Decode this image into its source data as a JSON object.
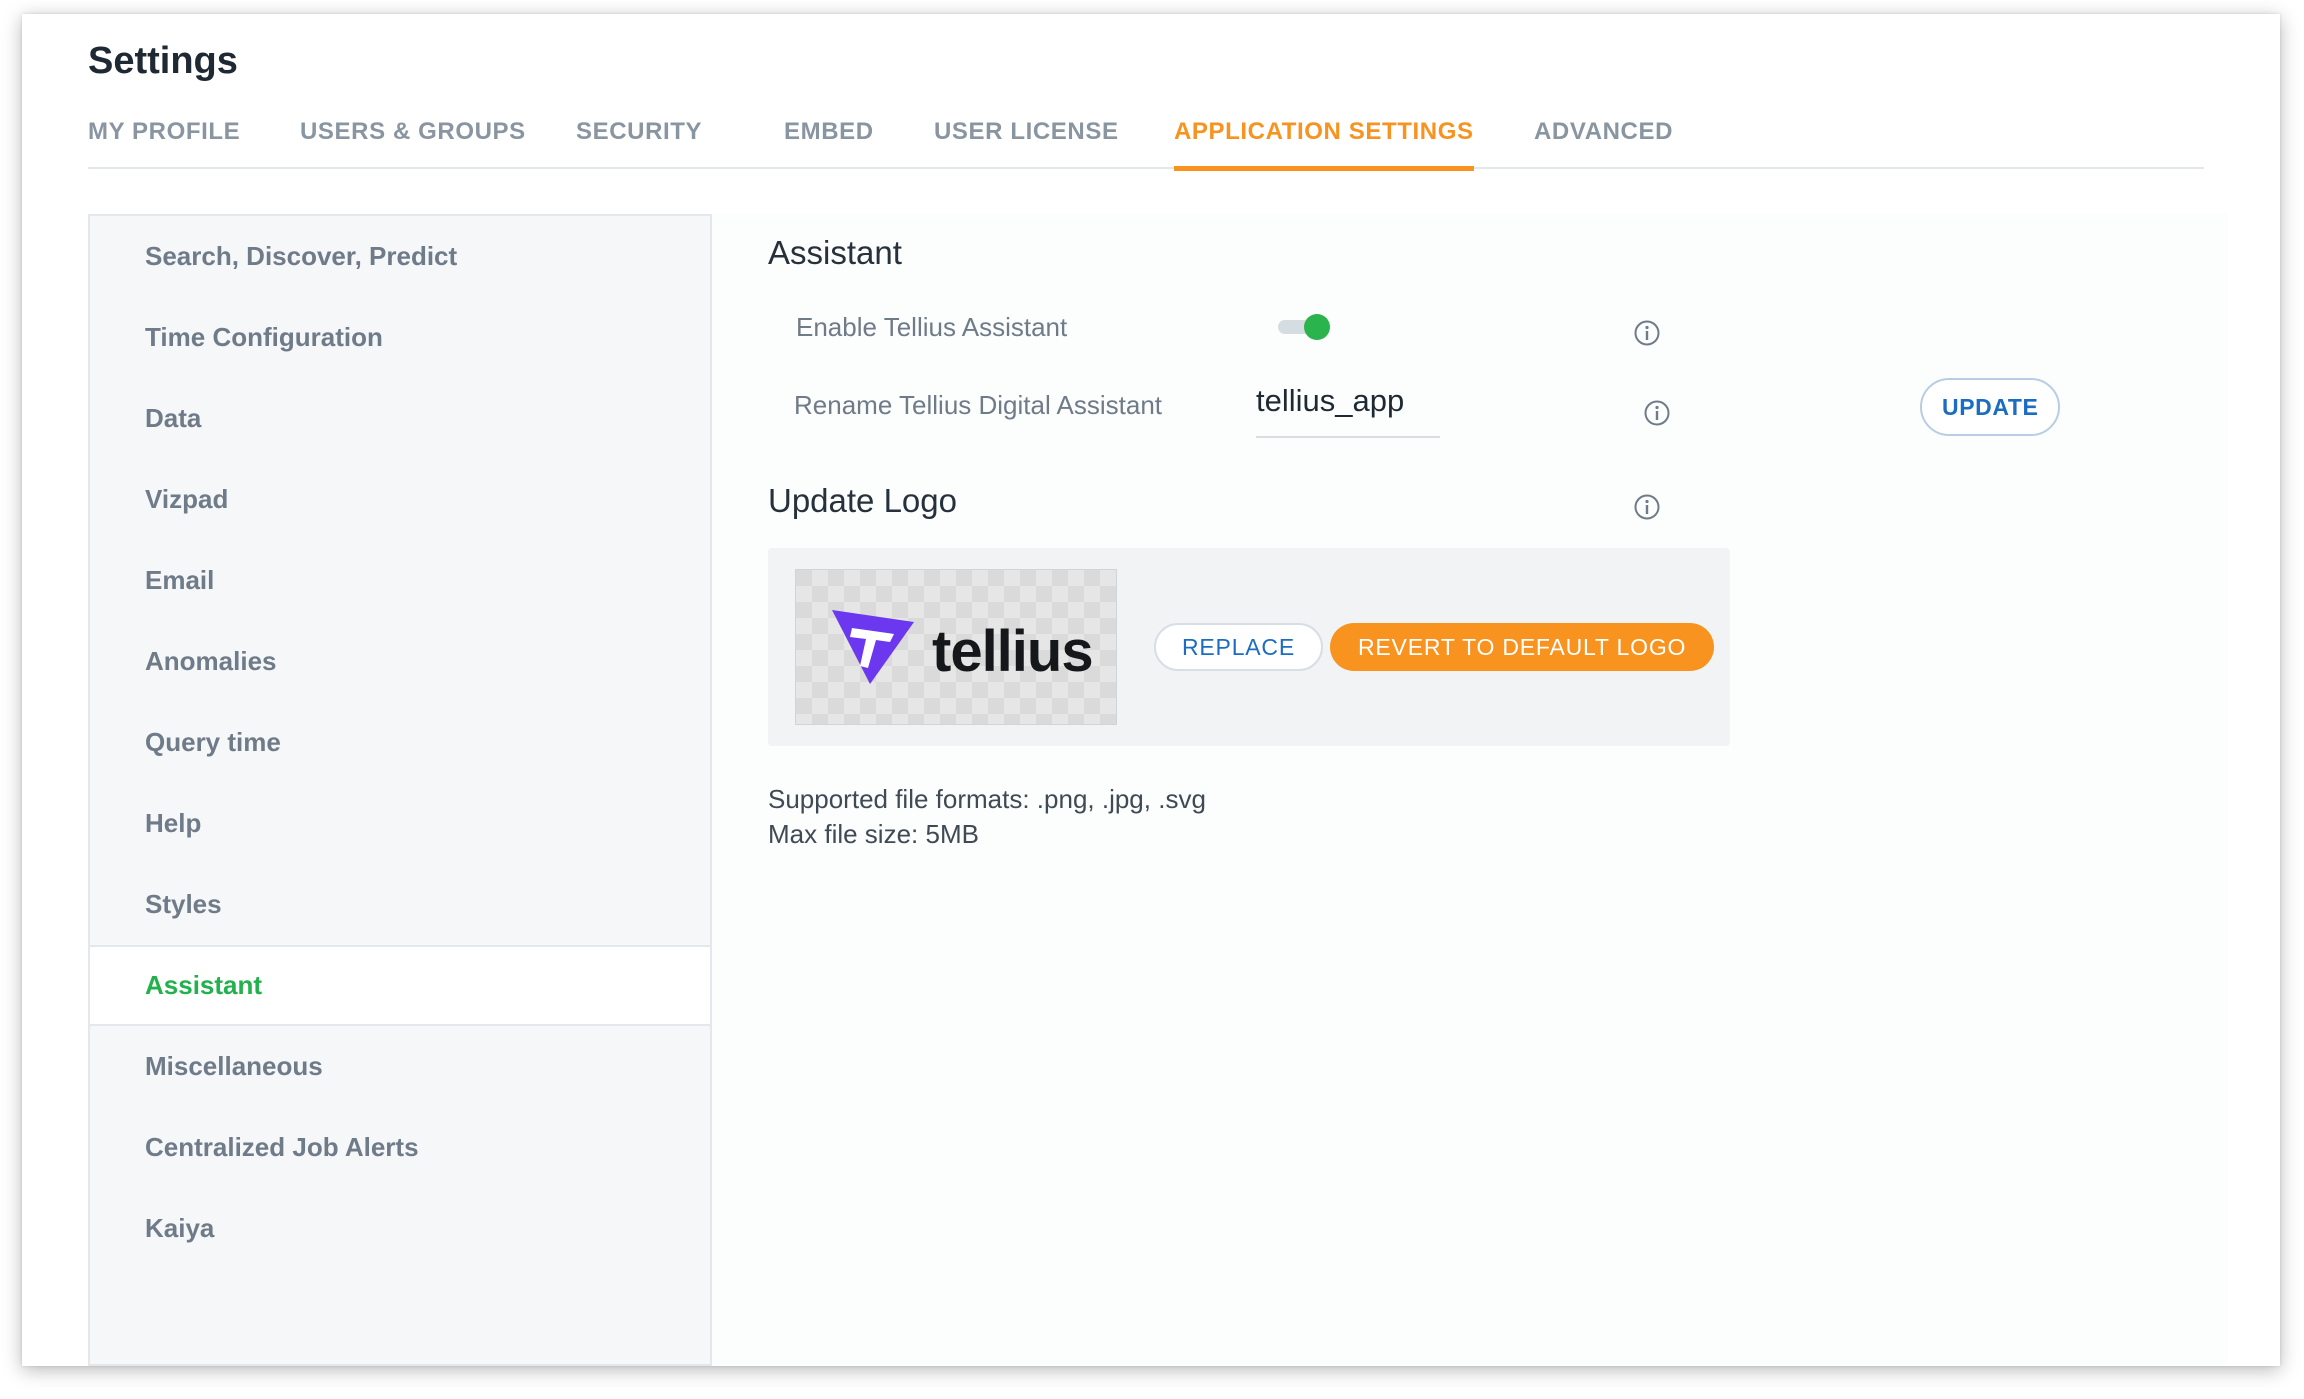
{
  "header": {
    "title": "Settings"
  },
  "tabs": [
    {
      "label": "MY PROFILE"
    },
    {
      "label": "USERS & GROUPS"
    },
    {
      "label": "SECURITY"
    },
    {
      "label": "EMBED"
    },
    {
      "label": "USER LICENSE"
    },
    {
      "label": "APPLICATION SETTINGS",
      "active": true
    },
    {
      "label": "ADVANCED"
    }
  ],
  "sidebar": {
    "items": [
      {
        "label": "Search, Discover, Predict"
      },
      {
        "label": "Time Configuration"
      },
      {
        "label": "Data"
      },
      {
        "label": "Vizpad"
      },
      {
        "label": "Email"
      },
      {
        "label": "Anomalies"
      },
      {
        "label": "Query time"
      },
      {
        "label": "Help"
      },
      {
        "label": "Styles"
      },
      {
        "label": "Assistant",
        "active": true
      },
      {
        "label": "Miscellaneous"
      },
      {
        "label": "Centralized Job Alerts"
      },
      {
        "label": "Kaiya"
      }
    ]
  },
  "assistant": {
    "title": "Assistant",
    "enable_label": "Enable Tellius Assistant",
    "enabled": true,
    "rename_label": "Rename Tellius Digital Assistant",
    "name_value": "tellius_app",
    "update_button": "UPDATE"
  },
  "logo": {
    "title": "Update Logo",
    "logo_text": "tellius",
    "replace_button": "REPLACE",
    "revert_button": "REVERT TO DEFAULT LOGO",
    "formats_note": "Supported file formats: .png, .jpg, .svg",
    "size_note": "Max file size: 5MB"
  },
  "colors": {
    "accent": "#f7931e",
    "active_sidebar": "#22b14c",
    "link": "#1b6dc1",
    "toggle_on": "#2bb34e"
  },
  "icons": {
    "info": "info-circle-icon",
    "logo_mark": "tellius-logo-mark"
  }
}
